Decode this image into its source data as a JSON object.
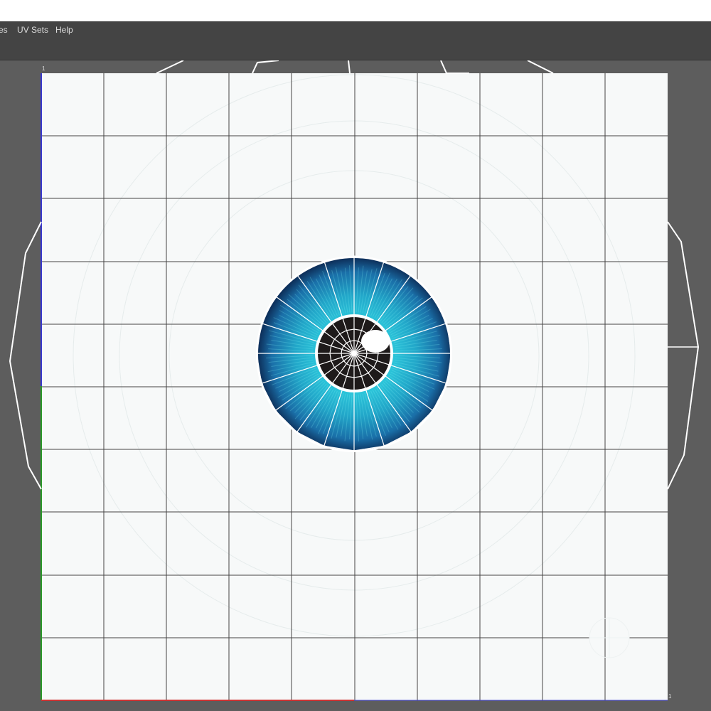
{
  "menubar": {
    "items": [
      {
        "label": "es"
      },
      {
        "label": "UV Sets"
      },
      {
        "label": "Help"
      }
    ]
  },
  "uv_editor": {
    "grid_labels": {
      "origin_top": "1",
      "corner_br": "1"
    },
    "colors": {
      "canvas": "#f7f9f9",
      "grid_line": "#444444",
      "viewport_bg": "#5d5d5d",
      "u_axis": "#cc3333",
      "v_axis_lower": "#2a9a2a",
      "v_axis_upper": "#3a3ad0",
      "wire": "#ffffff",
      "iris_dark": "#0d2f5a",
      "iris_mid": "#1a78b0",
      "iris_light": "#2fd0e0",
      "pupil": "#1e1a1a"
    }
  }
}
